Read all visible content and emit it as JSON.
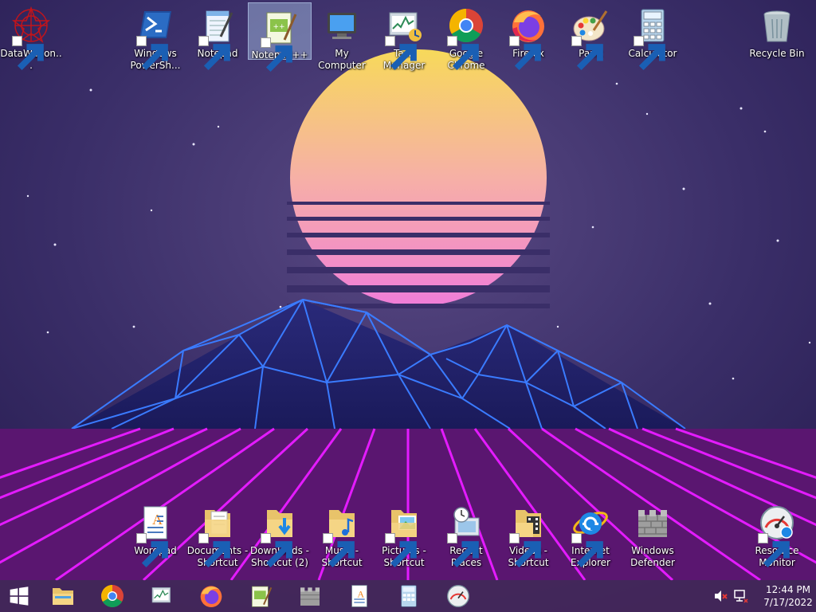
{
  "desktop": {
    "top_icons": [
      {
        "name": "datawagon-icon",
        "label": "DataWagon..."
      },
      {
        "name": "windows-powershell-icon",
        "label": "Windows PowerSh..."
      },
      {
        "name": "notepad-icon",
        "label": "Notepad"
      },
      {
        "name": "notepad-plus-plus-icon",
        "label": "Notepad++"
      },
      {
        "name": "my-computer-icon",
        "label": "My Computer"
      },
      {
        "name": "task-manager-icon",
        "label": "Task Manager"
      },
      {
        "name": "google-chrome-icon",
        "label": "Google Chrome"
      },
      {
        "name": "firefox-icon",
        "label": "Firefox"
      },
      {
        "name": "paint-icon",
        "label": "Paint"
      },
      {
        "name": "calculator-icon",
        "label": "Calculator"
      },
      {
        "name": "recycle-bin-icon",
        "label": "Recycle Bin"
      }
    ],
    "bottom_icons": [
      {
        "name": "wordpad-icon",
        "label": "Wordpad"
      },
      {
        "name": "documents-shortcut-icon",
        "label": "Documents - Shortcut"
      },
      {
        "name": "downloads-shortcut-icon",
        "label": "Downloads - Shortcut (2)"
      },
      {
        "name": "music-shortcut-icon",
        "label": "Music - Shortcut"
      },
      {
        "name": "pictures-shortcut-icon",
        "label": "Pictures - Shortcut"
      },
      {
        "name": "recent-places-icon",
        "label": "Recent Places"
      },
      {
        "name": "videos-shortcut-icon",
        "label": "Videos - Shortcut"
      },
      {
        "name": "internet-explorer-icon",
        "label": "Internet Explorer"
      },
      {
        "name": "windows-defender-icon",
        "label": "Windows Defender"
      },
      {
        "name": "resource-monitor-icon",
        "label": "Resource Monitor"
      }
    ]
  },
  "taskbar": {
    "pinned": [
      "file-explorer-icon",
      "chrome-icon",
      "task-manager-icon",
      "firefox-icon",
      "notepad-plus-plus-icon",
      "windows-defender-icon",
      "wordpad-icon",
      "calculator-icon",
      "resource-monitor-icon"
    ],
    "clock": {
      "time": "12:44 PM",
      "date": "7/17/2022"
    }
  },
  "colors": {
    "taskbar": "#46285a",
    "grid": "#e41bff",
    "mountain_lines": "#3a7bff",
    "sun_top": "#f7d95a",
    "sun_bottom": "#f48bd6"
  }
}
